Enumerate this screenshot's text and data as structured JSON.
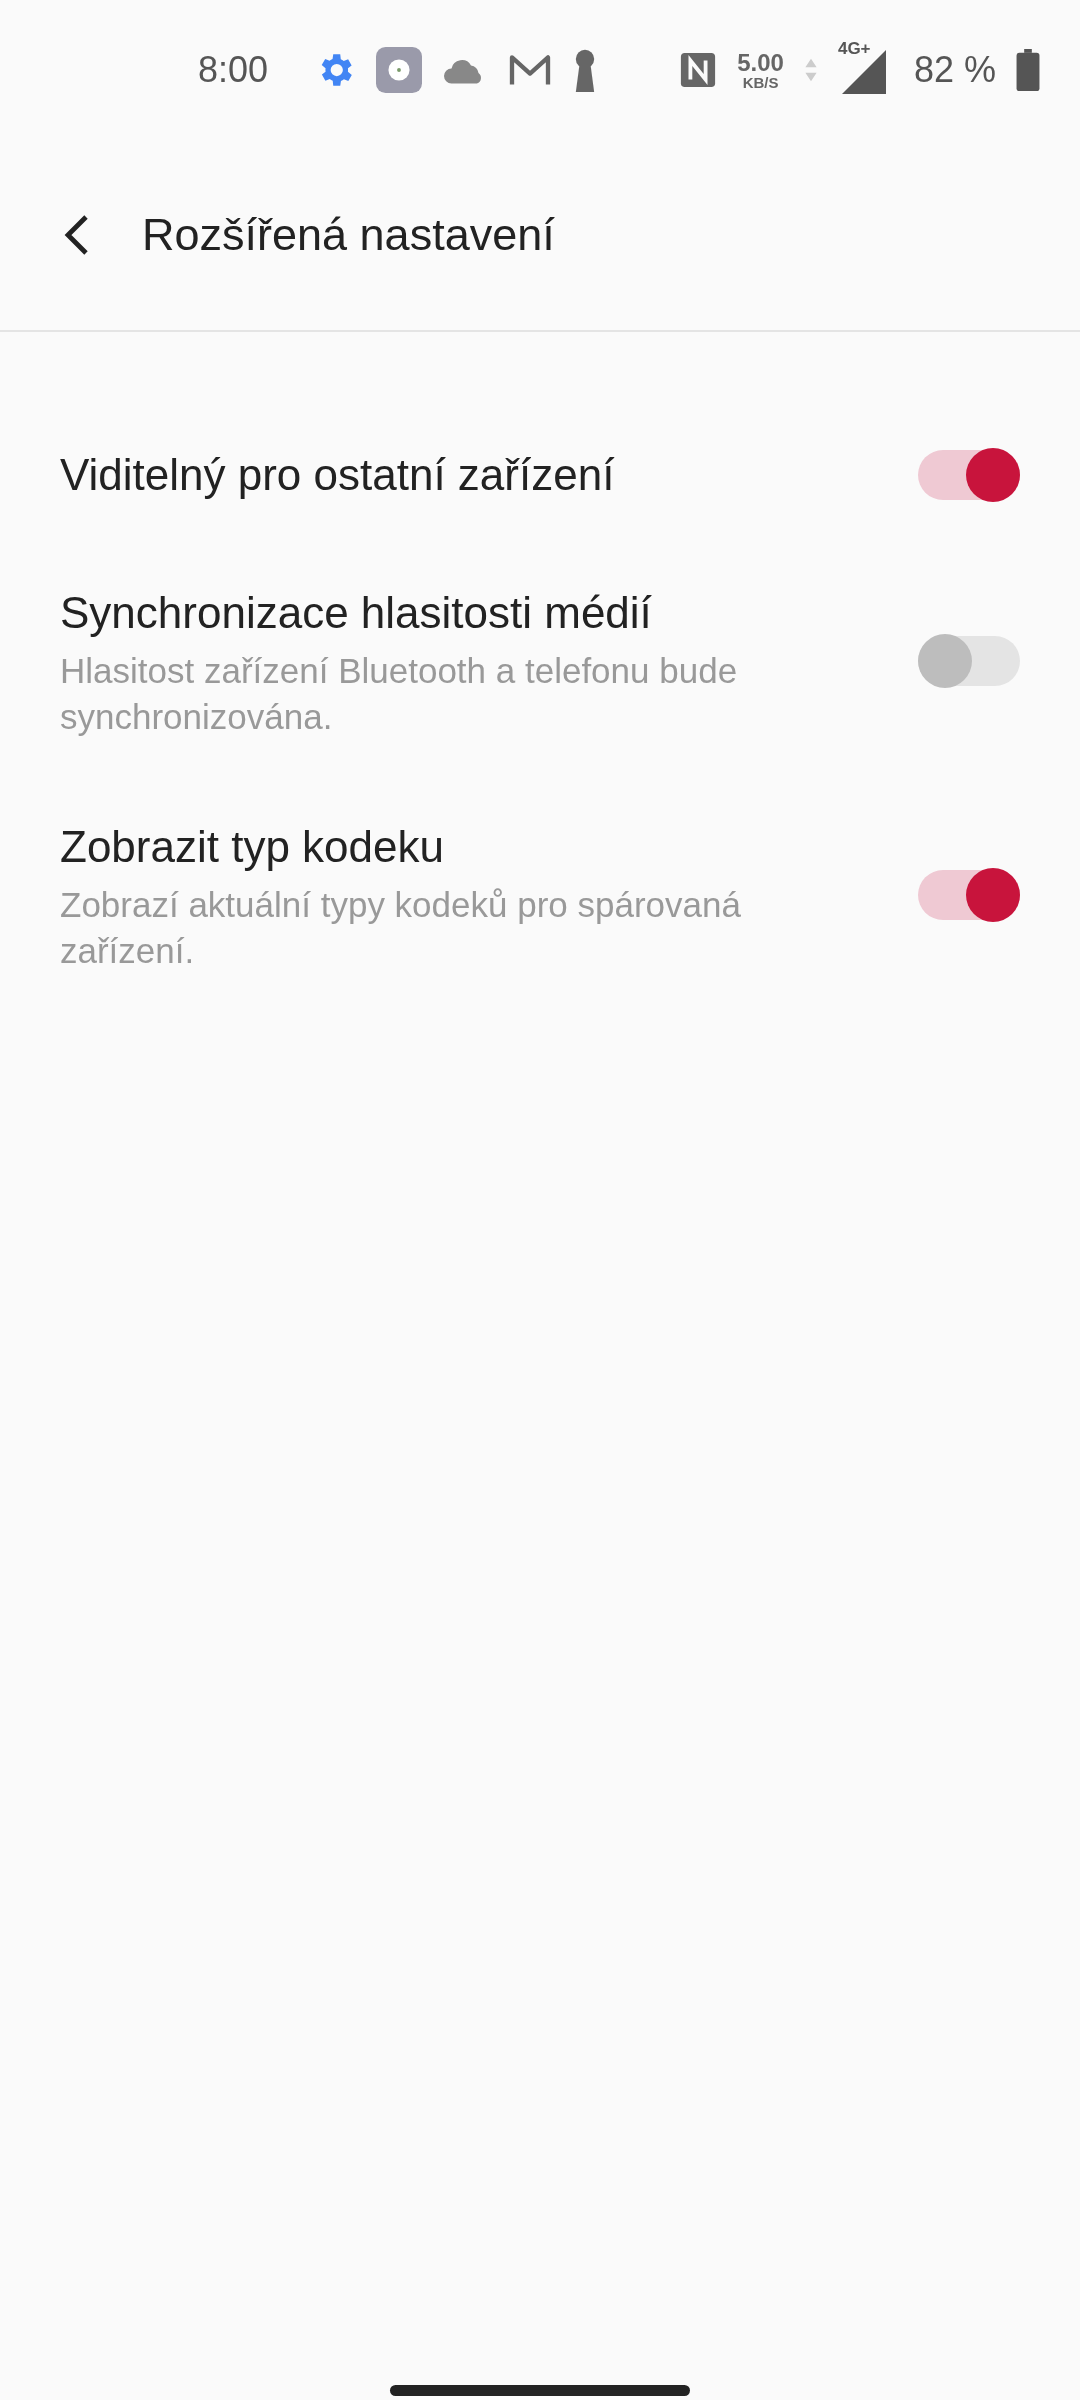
{
  "status_bar": {
    "time": "8:00",
    "speed_value": "5.00",
    "speed_unit": "KB/S",
    "network": "4G+",
    "battery": "82 %"
  },
  "header": {
    "title": "Rozšířená nastavení"
  },
  "settings": [
    {
      "title": "Viditelný pro ostatní zařízení",
      "on": true
    },
    {
      "title": "Synchronizace hlasitosti médií",
      "subtitle": "Hlasitost zařízení Bluetooth a telefonu bude synchronizována.",
      "on": false
    },
    {
      "title": "Zobrazit typ kodeku",
      "subtitle": "Zobrazí aktuální typy kodeků pro spárovaná zařízení.",
      "on": true
    }
  ]
}
